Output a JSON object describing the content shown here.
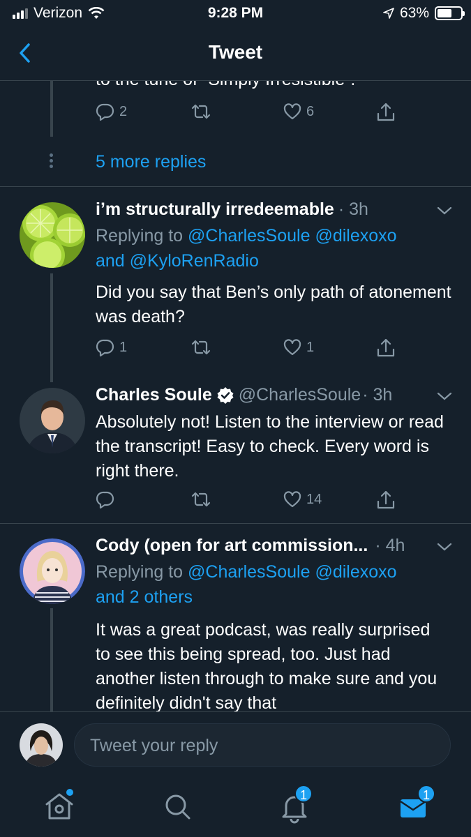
{
  "status_bar": {
    "carrier": "Verizon",
    "time": "9:28 PM",
    "battery": "63%",
    "battery_level": 0.63
  },
  "header": {
    "title": "Tweet",
    "back_icon": "chevron-left-icon"
  },
  "prev_tweet": {
    "cut_text": "to the tune of “Simply Irresistible”.",
    "reply_count": "2",
    "retweet_count": "",
    "like_count": "6",
    "more_replies": "5 more replies"
  },
  "tweets": [
    {
      "name": "i’m structurally irredeemable",
      "handle": "",
      "time": "· 3h",
      "replying_prefix": "Replying to",
      "replying_mentions": "@CharlesSoule @dilexoxo",
      "replying_line2": "and @KyloRenRadio",
      "body": "Did you say that Ben’s only path of atonement was death?",
      "reply_count": "1",
      "like_count": "1"
    },
    {
      "name": "Charles Soule",
      "handle": "@CharlesSoule",
      "time": "· 3h",
      "verified": true,
      "body": "Absolutely not! Listen to the interview or read the transcript! Easy to check. Every word is right there.",
      "reply_count": "",
      "like_count": "14"
    },
    {
      "name": "Cody (open for art commission...",
      "handle": "",
      "time": "· 4h",
      "replying_prefix": "Replying to",
      "replying_mentions": "@CharlesSoule @dilexoxo",
      "replying_line2": "and 2 others",
      "body": "It was a great podcast, was really surprised to see this being spread, too. Just had another listen through to make sure and you definitely didn't say that"
    }
  ],
  "reply_bar": {
    "placeholder": "Tweet your reply"
  },
  "tabs": {
    "notifications_badge": "1",
    "messages_badge": "1"
  },
  "colors": {
    "background": "#15202b",
    "accent": "#1da1f2",
    "secondary_text": "#8899a6",
    "border": "#38444d"
  }
}
